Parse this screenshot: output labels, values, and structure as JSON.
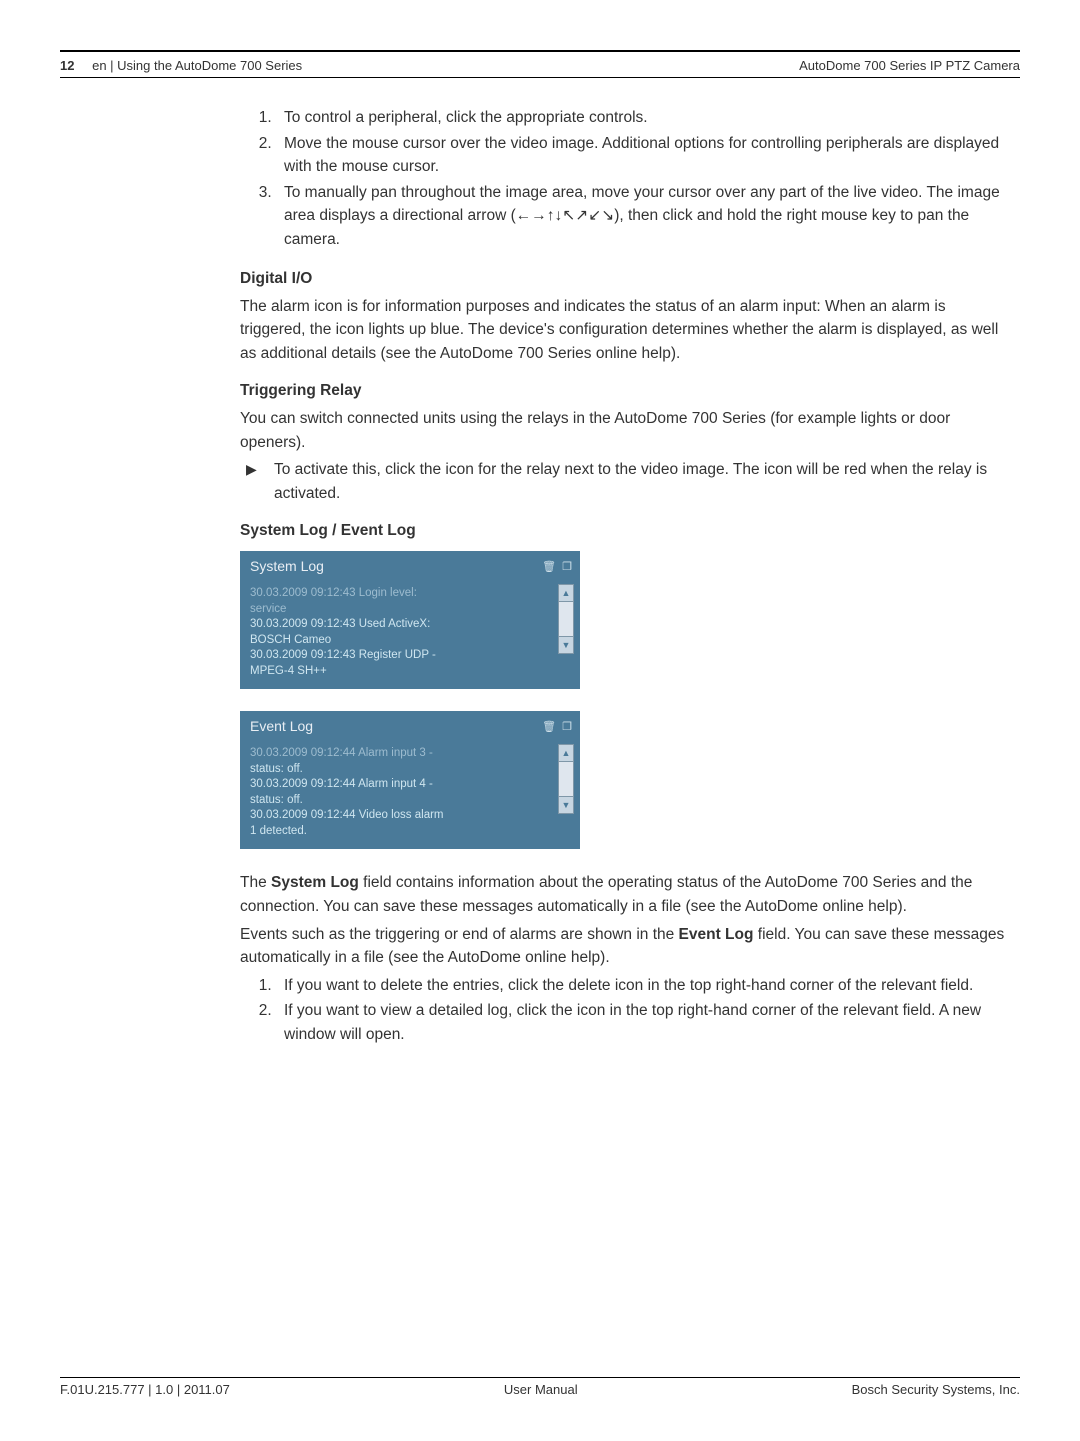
{
  "header": {
    "page_number": "12",
    "left_text": "en | Using the AutoDome 700 Series",
    "right_text": "AutoDome 700 Series IP PTZ Camera"
  },
  "intro_list": [
    "To control a peripheral, click the appropriate controls.",
    "Move the mouse cursor over the video image. Additional options for controlling peripherals are displayed with the mouse cursor.",
    "To manually pan throughout the image area, move your cursor over any part of the live video. The image area displays a directional arrow (←→↑↓↖↗↙↘), then click and hold the right mouse key to pan the camera."
  ],
  "digital_io": {
    "heading": "Digital I/O",
    "text": "The alarm icon is for information purposes and indicates the status of an alarm input: When an alarm is triggered, the icon lights up blue. The device's configuration determines whether the alarm is displayed, as well as additional details (see the AutoDome 700 Series online help)."
  },
  "triggering_relay": {
    "heading": "Triggering Relay",
    "intro": "You can switch connected units using the relays in the AutoDome 700 Series (for example lights or door openers).",
    "bullet": "To activate this, click the icon for the relay next to the video image. The icon will be red when the relay is activated."
  },
  "logs": {
    "heading": "System Log / Event Log",
    "system": {
      "title": "System Log",
      "lines": [
        "30.03.2009 09:12:43 Login level:",
        "service",
        "30.03.2009 09:12:43 Used ActiveX:",
        "BOSCH Cameo",
        "30.03.2009 09:12:43 Register UDP -",
        "MPEG-4 SH++"
      ]
    },
    "event": {
      "title": "Event Log",
      "lines": [
        "30.03.2009 09:12:44 Alarm input 3 -",
        "status: off.",
        "30.03.2009 09:12:44 Alarm input 4 -",
        "status: off.",
        "30.03.2009 09:12:44 Video loss alarm",
        "1 detected."
      ]
    }
  },
  "post": {
    "p1a": "The ",
    "p1b": "System Log",
    "p1c": " field contains information about the operating status of the AutoDome 700 Series and the connection. You can save these messages automatically in a file (see the AutoDome online help).",
    "p2a": "Events such as the triggering or end of alarms are shown in the ",
    "p2b": "Event Log",
    "p2c": " field. You can save these messages automatically in a file (see the AutoDome online help).",
    "list": [
      "If you want to delete the entries, click the delete icon in the top right-hand corner of the relevant field.",
      "If you want to view a detailed log, click the icon in the top right-hand corner of the relevant field. A new window will open."
    ]
  },
  "footer": {
    "left": "F.01U.215.777 | 1.0 | 2011.07",
    "center": "User Manual",
    "right": "Bosch Security Systems, Inc."
  }
}
